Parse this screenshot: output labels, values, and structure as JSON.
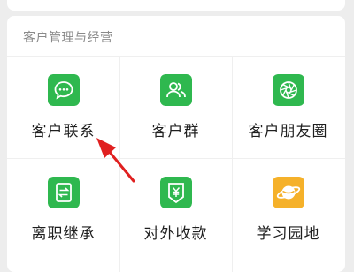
{
  "section": {
    "title": "客户管理与经营"
  },
  "tiles": [
    {
      "label": "客户联系",
      "icon": "chat-bubble-icon",
      "color": "#2fb84f"
    },
    {
      "label": "客户群",
      "icon": "group-people-icon",
      "color": "#2fb84f"
    },
    {
      "label": "客户朋友圈",
      "icon": "aperture-icon",
      "color": "#2fb84f"
    },
    {
      "label": "离职继承",
      "icon": "transfer-icon",
      "color": "#2fb84f"
    },
    {
      "label": "对外收款",
      "icon": "yuan-shield-icon",
      "color": "#2fb84f"
    },
    {
      "label": "学习园地",
      "icon": "planet-icon",
      "color": "#f5b12a"
    }
  ],
  "annotation": {
    "arrow_color": "#e02020"
  }
}
